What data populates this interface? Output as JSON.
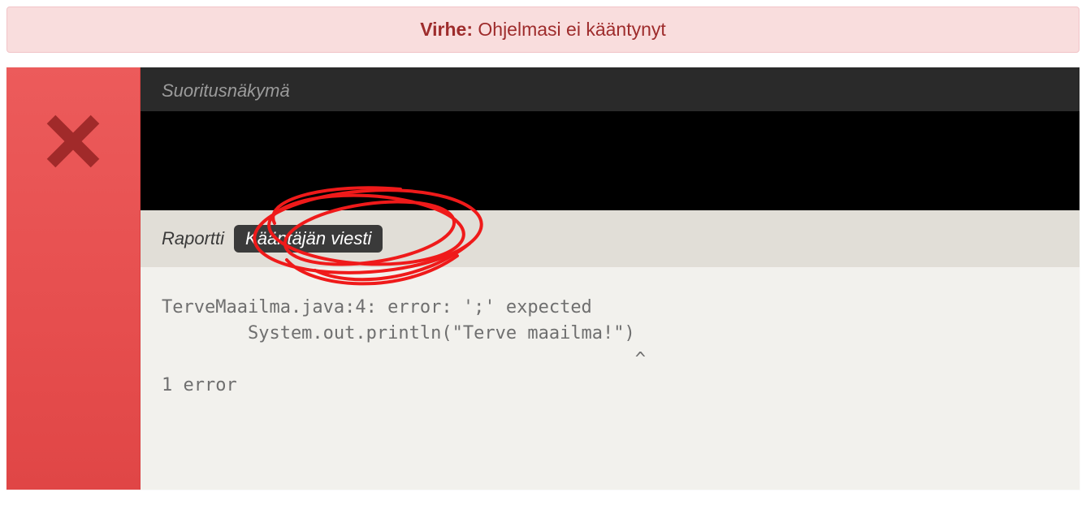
{
  "alert": {
    "label": "Virhe:",
    "message": "Ohjelmasi ei kääntynyt"
  },
  "panel": {
    "exec_view_title": "Suoritusnäkymä",
    "tabs": {
      "report": "Raportti",
      "compiler": "Kääntäjän viesti"
    },
    "compiler_output": "TerveMaailma.java:4: error: ';' expected\n        System.out.println(\"Terve maailma!\")\n                                            ^\n1 error"
  },
  "icons": {
    "error_x": "close-x-icon"
  }
}
